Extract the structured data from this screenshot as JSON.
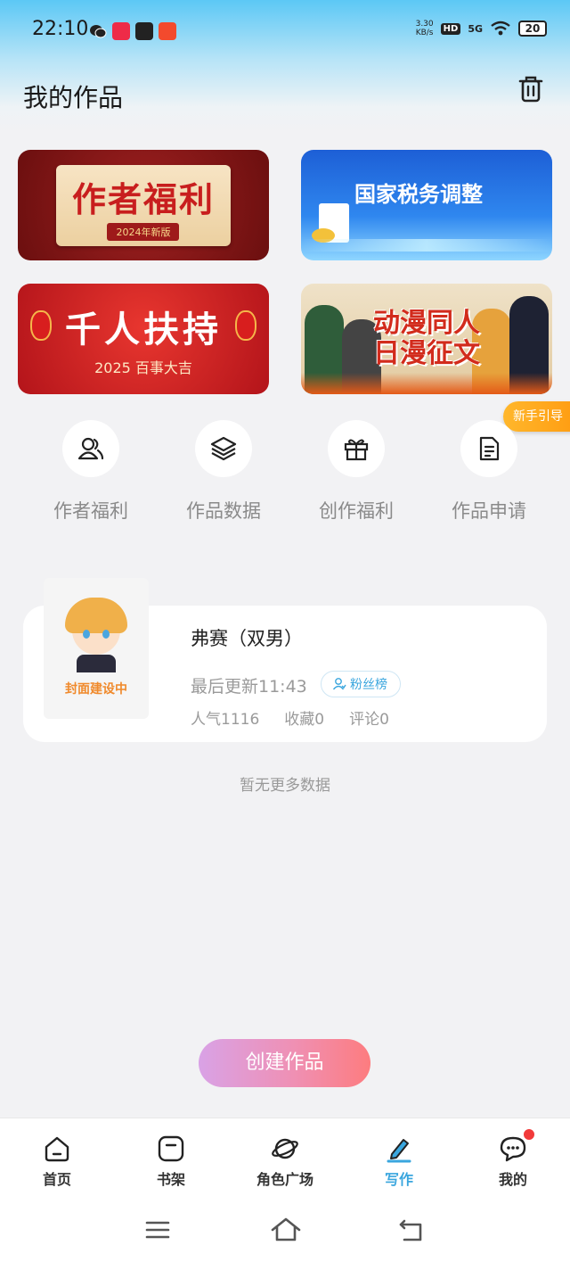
{
  "status_bar": {
    "time": "22:10",
    "speed_top": "3.30",
    "speed_bottom": "KB/s",
    "hd": "HD",
    "network": "5G",
    "battery": "20"
  },
  "header": {
    "title": "我的作品",
    "trash_icon": "trash-icon"
  },
  "banners": [
    {
      "title": "作者福利",
      "subtitle": "2024年新版",
      "accent": "#c81e1e"
    },
    {
      "title": "国家税务调整",
      "accent": "#1d5fd6"
    },
    {
      "title": "千人扶持",
      "subtitle": "2025 百事大吉",
      "accent": "#d81e1e"
    },
    {
      "title_line1": "动漫同人",
      "title_line2": "日漫征文",
      "accent": "#d22b1c"
    }
  ],
  "guide_label": "新手引导",
  "quick_actions": [
    {
      "label": "作者福利",
      "icon": "users-icon"
    },
    {
      "label": "作品数据",
      "icon": "layers-icon"
    },
    {
      "label": "创作福利",
      "icon": "gift-icon"
    },
    {
      "label": "作品申请",
      "icon": "document-icon"
    }
  ],
  "work": {
    "cover_text": "封面建设中",
    "title": "弗赛（双男）",
    "updated": "最后更新11:43",
    "fan_rank": "粉丝榜",
    "popularity": "人气1116",
    "favorites": "收藏0",
    "comments": "评论0"
  },
  "no_more": "暂无更多数据",
  "create_button": "创建作品",
  "nav": [
    {
      "label": "首页",
      "icon": "home-icon",
      "active": false
    },
    {
      "label": "书架",
      "icon": "bookshelf-icon",
      "active": false
    },
    {
      "label": "角色广场",
      "icon": "planet-icon",
      "active": false
    },
    {
      "label": "写作",
      "icon": "pen-icon",
      "active": true
    },
    {
      "label": "我的",
      "icon": "message-icon",
      "active": false,
      "badge": true
    }
  ],
  "colors": {
    "accent": "#3aa6de",
    "badge": "#f23a3a",
    "guide": "#ffa51c"
  }
}
